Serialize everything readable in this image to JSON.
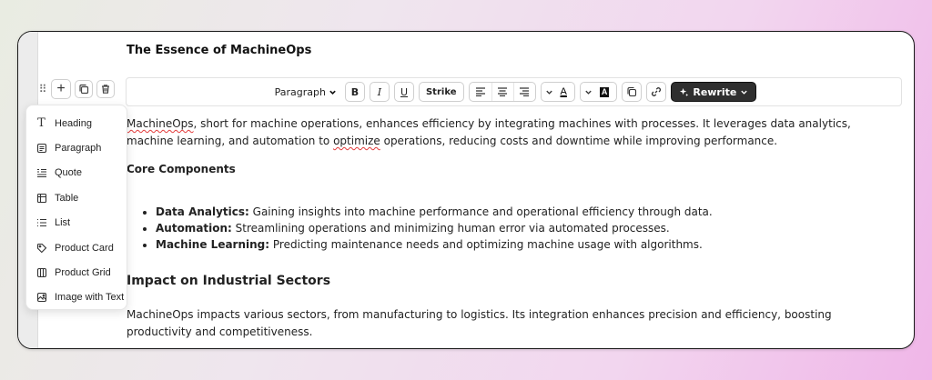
{
  "document": {
    "title": "The Essence of MachineOps"
  },
  "toolbar": {
    "block_type": "Paragraph",
    "bold": "B",
    "italic": "I",
    "underline": "U",
    "strike": "Strike",
    "text_color": "A",
    "bg_color": "A",
    "rewrite": "Rewrite"
  },
  "content": {
    "intro_spell_1": "MachineOps",
    "intro_part_1": ", short for machine operations, enhances efficiency by integrating machines with processes. It leverages data analytics, machine learning, and automation to ",
    "intro_spell_2": "optimize",
    "intro_part_2": " operations, reducing costs and downtime while improving performance.",
    "core_heading": "Core Components",
    "bullets": [
      {
        "label": "Data Analytics:",
        "text": " Gaining insights into machine performance and operational efficiency through data."
      },
      {
        "label": "Automation:",
        "text": " Streamlining operations and minimizing human error via automated processes."
      },
      {
        "label": "Machine Learning:",
        "text": " Predicting maintenance needs and optimizing machine usage with algorithms."
      }
    ],
    "impact_heading": "Impact on Industrial Sectors",
    "impact_text": "MachineOps impacts various sectors, from manufacturing to logistics. Its integration enhances precision and efficiency, boosting productivity and competitiveness."
  },
  "insert_menu": {
    "items": [
      {
        "label": "Heading",
        "icon": "heading-icon"
      },
      {
        "label": "Paragraph",
        "icon": "paragraph-icon"
      },
      {
        "label": "Quote",
        "icon": "quote-icon"
      },
      {
        "label": "Table",
        "icon": "table-icon"
      },
      {
        "label": "List",
        "icon": "list-icon"
      },
      {
        "label": "Product Card",
        "icon": "tag-icon"
      },
      {
        "label": "Product Grid",
        "icon": "grid-icon"
      },
      {
        "label": "Image with Text",
        "icon": "image-icon"
      }
    ]
  },
  "colors": {
    "rewrite_bg": "#2f2f2f",
    "spell_error": "#e23b3b"
  }
}
